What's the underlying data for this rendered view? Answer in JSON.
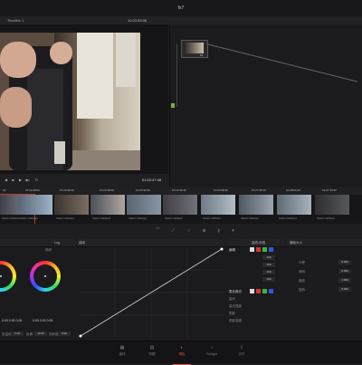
{
  "window": {
    "title": "fx7"
  },
  "viewer": {
    "timeline_name": "Timeline 1",
    "source_timecode": "10:23:53:06",
    "current_timecode": "01:02:47:48"
  },
  "node_graph": {
    "node_label": "01"
  },
  "clips": [
    {
      "num": "01",
      "tc": "10:23:28:02",
      "label": "SHHC MPEG4"
    },
    {
      "num": "02",
      "tc": "10:23:30:46",
      "label": "SHHC MPEG4"
    },
    {
      "num": "03",
      "tc": "10:23:38:08",
      "label": "SHHC MPEG4"
    },
    {
      "num": "04",
      "tc": "10:23:39:30",
      "label": "SHHC MPEG4"
    },
    {
      "num": "05",
      "tc": "10:23:30:46",
      "label": "SHHC MPEG4"
    },
    {
      "num": "06",
      "tc": "10:22:58:46",
      "label": "SHHC MPEG4"
    },
    {
      "num": "07",
      "tc": "10:27:38:16",
      "label": "SHHC MPEG4"
    },
    {
      "num": "08",
      "tc": "10:28:00:42",
      "label": "SHHC MPEG4"
    },
    {
      "num": "09",
      "tc": "10:37:33:30",
      "label": "SHHC MPEG4"
    },
    {
      "num": "10",
      "tc": "10:30:33:24",
      "label": "SHHC MPEG4"
    }
  ],
  "color_panel": {
    "mode_label": "Log",
    "curves_label": "曲线",
    "wheels_label": "饱和",
    "wheel_values": [
      "0.00  0.00  0.00",
      "0.00  0.00  0.00"
    ],
    "bottom": {
      "temp_label": "色温调整",
      "temp_val": "0.00",
      "tint_label": "色调",
      "tint_val": "10.00",
      "sat_label": "饱和度",
      "sat_val": "0.00"
    }
  },
  "right_panel": {
    "header": "曲线-色相",
    "rgb_label": "编辑",
    "rgb_values": [
      "100",
      "100",
      "100",
      "100"
    ],
    "soft_label": "柔化裁切",
    "rows": [
      "高光",
      "高光强度",
      "阴影",
      "阴影强度"
    ]
  },
  "keyframe_panel": {
    "header": "键帧大小",
    "rows": [
      {
        "label": "平移",
        "value": "0.000"
      },
      {
        "label": "倾斜",
        "value": "0.000"
      },
      {
        "label": "缩放",
        "value": "1.000"
      },
      {
        "label": "旋转",
        "value": "0.000"
      }
    ]
  },
  "pages": [
    {
      "label": "媒体",
      "icon": "media-icon"
    },
    {
      "label": "剪辑",
      "icon": "edit-icon"
    },
    {
      "label": "调色",
      "icon": "color-icon",
      "active": true
    },
    {
      "label": "Fairlight",
      "icon": "audio-icon"
    },
    {
      "label": "交付",
      "icon": "deliver-icon"
    }
  ],
  "colors": {
    "accent": "#e84a4a",
    "node_green": "#7bb33a"
  }
}
